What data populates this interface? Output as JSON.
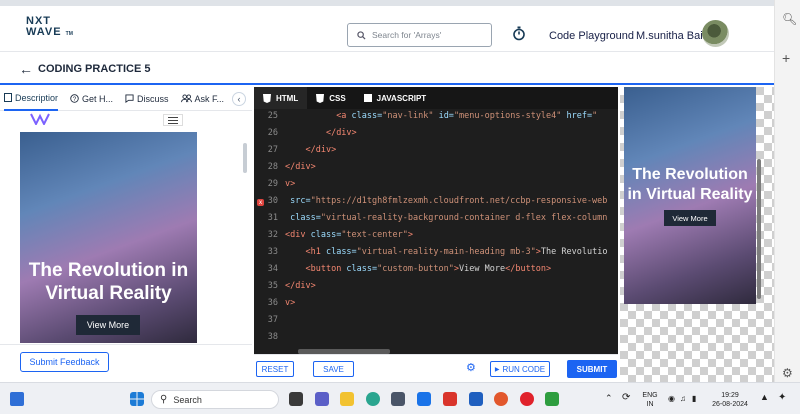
{
  "header": {
    "logo_line1": "NXT",
    "logo_line2": "WAVE",
    "logo_tm": "TM",
    "search_placeholder": "Search for 'Arrays'",
    "code_playground_label": "Code Playground",
    "user_name": "M.sunitha Bai"
  },
  "practice": {
    "title": "CODING PRACTICE 5"
  },
  "left_tabs": [
    {
      "label": "Descriptior",
      "icon": "doc-icon"
    },
    {
      "label": "Get H...",
      "icon": "help-icon"
    },
    {
      "label": "Discuss",
      "icon": "chat-icon"
    },
    {
      "label": "Ask F...",
      "icon": "people-icon"
    }
  ],
  "preview": {
    "heading": "The Revolution in Virtual Reality",
    "button": "View More"
  },
  "left_footer": {
    "submit_feedback": "Submit Feedback"
  },
  "editor": {
    "tabs": [
      "HTML",
      "CSS",
      "JAVASCRIPT"
    ],
    "lines": [
      {
        "n": "25",
        "parts": [
          [
            "t",
            "          "
          ],
          [
            "k",
            "<a"
          ],
          [
            "a",
            " class="
          ],
          [
            "s",
            "\"nav-link\""
          ],
          [
            "a",
            " id="
          ],
          [
            "s",
            "\"menu-options-style4\""
          ],
          [
            "a",
            " href="
          ],
          [
            "s",
            "\""
          ]
        ]
      },
      {
        "n": "26",
        "parts": [
          [
            "t",
            "        "
          ],
          [
            "k",
            "</div>"
          ]
        ]
      },
      {
        "n": "27",
        "parts": [
          [
            "t",
            "    "
          ],
          [
            "k",
            "</div>"
          ]
        ]
      },
      {
        "n": "28",
        "parts": [
          [
            "k",
            "</div>"
          ]
        ]
      },
      {
        "n": "29",
        "parts": [
          [
            "k",
            "v>"
          ]
        ]
      },
      {
        "n": "30",
        "parts": [
          [
            "a",
            " src="
          ],
          [
            "s",
            "\"https://d1tgh8fmlzexmh.cloudfront.net/ccbp-responsive-web"
          ]
        ],
        "error": true
      },
      {
        "n": "31",
        "parts": [
          [
            "a",
            " class="
          ],
          [
            "s",
            "\"virtual-reality-background-container d-flex flex-column"
          ]
        ]
      },
      {
        "n": "32",
        "parts": [
          [
            "k",
            "<div"
          ],
          [
            "a",
            " class="
          ],
          [
            "s",
            "\"text-center\""
          ],
          [
            "k",
            ">"
          ]
        ]
      },
      {
        "n": "33",
        "parts": [
          [
            "t",
            "    "
          ],
          [
            "k",
            "<h1"
          ],
          [
            "a",
            " class="
          ],
          [
            "s",
            "\"virtual-reality-main-heading mb-3\""
          ],
          [
            "k",
            ">"
          ],
          [
            "t",
            "The Revolutio"
          ]
        ]
      },
      {
        "n": "34",
        "parts": [
          [
            "t",
            "    "
          ],
          [
            "k",
            "<button"
          ],
          [
            "a",
            " class="
          ],
          [
            "s",
            "\"custom-button\""
          ],
          [
            "k",
            ">"
          ],
          [
            "t",
            "View More"
          ],
          [
            "k",
            "</button>"
          ]
        ]
      },
      {
        "n": "35",
        "parts": [
          [
            "k",
            "</div>"
          ]
        ]
      },
      {
        "n": "36",
        "parts": [
          [
            "k",
            "v>"
          ]
        ]
      },
      {
        "n": "37",
        "parts": []
      },
      {
        "n": "38",
        "parts": []
      }
    ],
    "reset": "RESET",
    "save": "SAVE",
    "run_code": "RUN CODE",
    "submit": "SUBMIT"
  },
  "taskbar": {
    "search": "Search",
    "lang_line1": "ENG",
    "lang_line2": "IN",
    "time": "19:29",
    "date": "26-08-2024"
  }
}
